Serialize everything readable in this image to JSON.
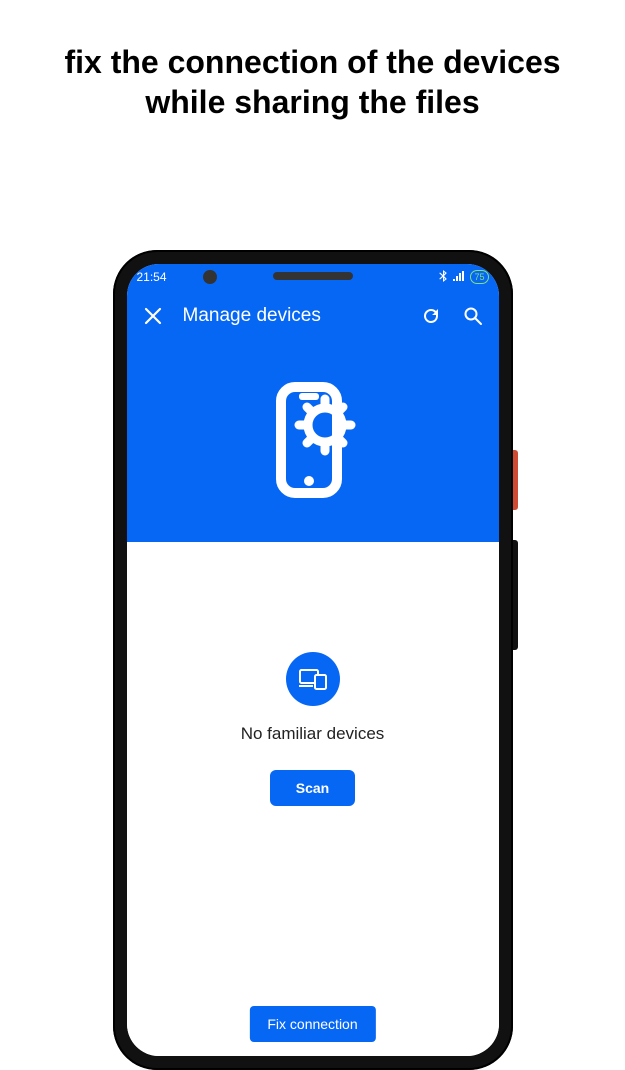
{
  "promo": {
    "headline": "fix the connection of the devices while sharing the files"
  },
  "status": {
    "time": "21:54",
    "battery": "75"
  },
  "appbar": {
    "title": "Manage devices"
  },
  "empty": {
    "message": "No familiar devices",
    "scan_label": "Scan"
  },
  "footer": {
    "fix_label": "Fix connection"
  },
  "colors": {
    "primary": "#0767f5"
  }
}
